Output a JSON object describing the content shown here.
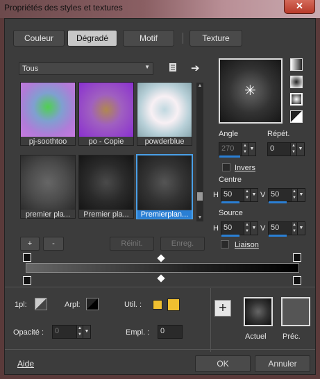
{
  "window": {
    "title": "Propriétés des styles et textures",
    "close_glyph": "✕"
  },
  "tabs": [
    {
      "label": "Couleur",
      "active": false
    },
    {
      "label": "Dégradé",
      "active": true
    },
    {
      "label": "Motif",
      "active": false
    },
    {
      "label": "Texture",
      "active": false
    }
  ],
  "category": {
    "value": "Tous"
  },
  "gradients": [
    {
      "label": "pj-soothtoo",
      "selected": false
    },
    {
      "label": "po - Copie",
      "selected": false
    },
    {
      "label": "powderblue",
      "selected": false
    },
    {
      "label": "premier pla...",
      "selected": false
    },
    {
      "label": "Premier pla...",
      "selected": false
    },
    {
      "label": "Premierplan...",
      "selected": true
    }
  ],
  "list_buttons": {
    "add": "+",
    "remove": "-",
    "reset": "Réinit.",
    "save": "Enreg."
  },
  "angle": {
    "label": "Angle",
    "value": "270"
  },
  "repeat": {
    "label": "Répét.",
    "value": "0"
  },
  "invert": {
    "label": "Invers",
    "checked": false
  },
  "center": {
    "label": "Centre",
    "h_label": "H",
    "h": "50",
    "v_label": "V",
    "v": "50"
  },
  "source": {
    "label": "Source",
    "h_label": "H",
    "h": "50",
    "v_label": "V",
    "v": "50"
  },
  "link": {
    "label": "Liaison",
    "checked": false
  },
  "bottom": {
    "fg_label": "1pl:",
    "bg_label": "Arpl:",
    "user_label": "Util. :",
    "opacity_label": "Opacité :",
    "opacity_value": "0",
    "location_label": "Empl. :",
    "location_value": "0",
    "current_label": "Actuel",
    "previous_label": "Préc.",
    "add_glyph": "+"
  },
  "footer": {
    "help": "Aide",
    "ok": "OK",
    "cancel": "Annuler"
  },
  "colors": {
    "accent": "#2a7fd4",
    "user_color": "#f0c030",
    "dialog_bg": "#3c3c3c"
  }
}
